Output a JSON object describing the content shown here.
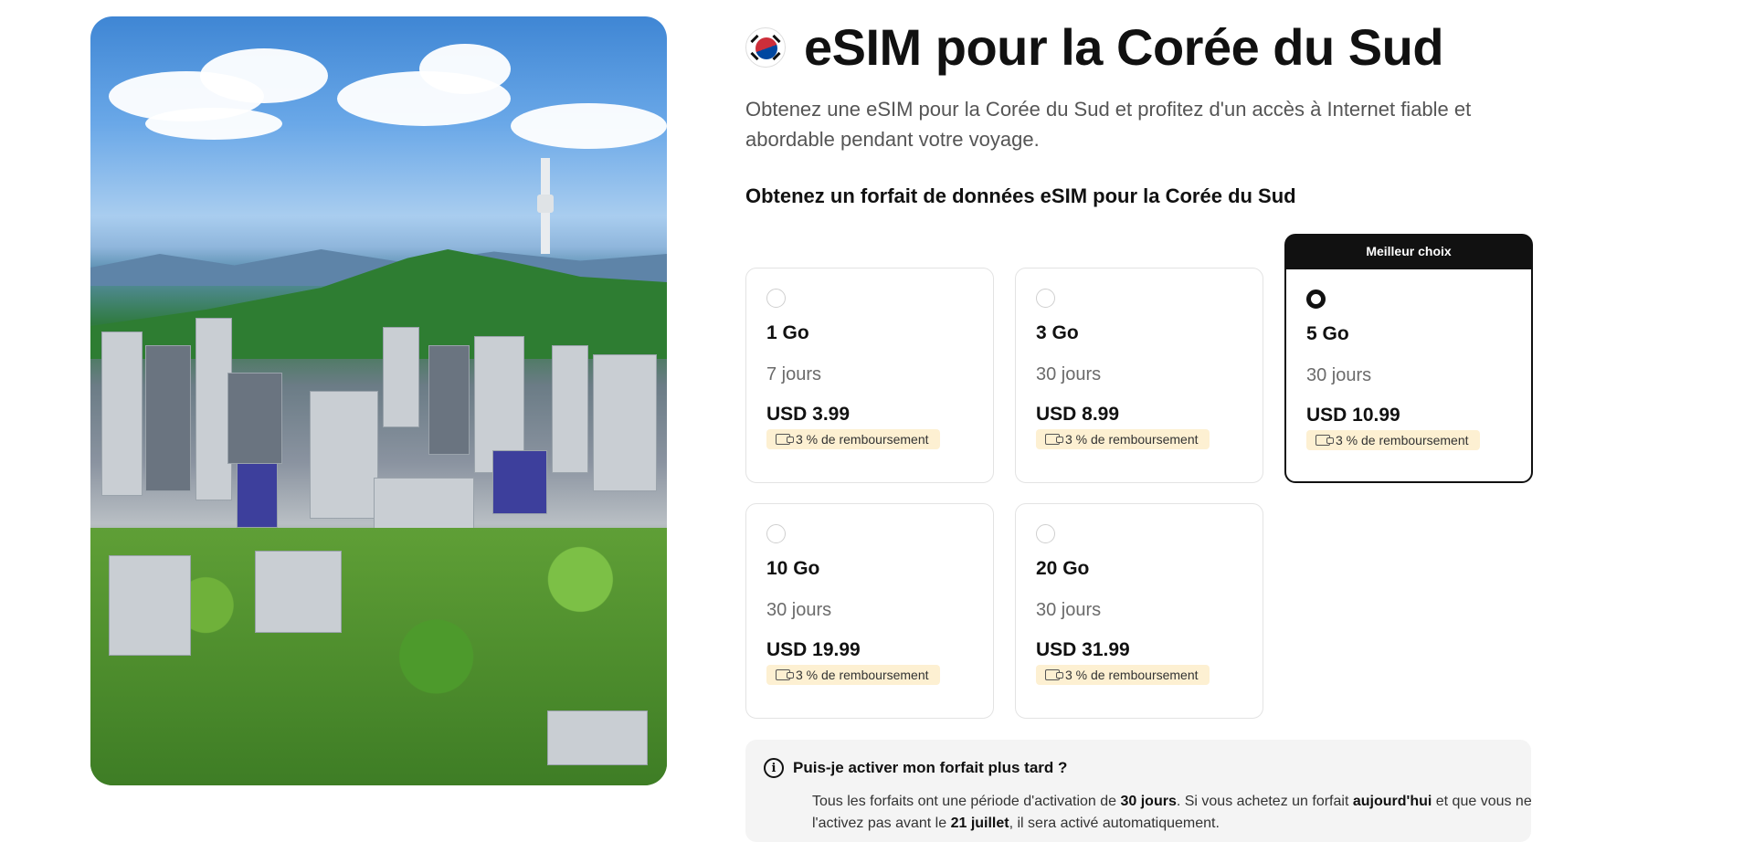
{
  "page": {
    "title": "eSIM pour la Corée du Sud",
    "subtitle": "Obtenez une eSIM pour la Corée du Sud et profitez d'un accès à Internet fiable et abordable pendant votre voyage.",
    "section_title": "Obtenez un forfait de données eSIM pour la Corée du Sud"
  },
  "hero_image": {
    "description_icon": "seoul-skyline-image"
  },
  "flag_icon": "south-korea-flag-icon",
  "plans": [
    {
      "data": "1 Go",
      "validity": "7 jours",
      "price": "USD 3.99",
      "cashback": "3 % de remboursement",
      "selected": false
    },
    {
      "data": "3 Go",
      "validity": "30 jours",
      "price": "USD 8.99",
      "cashback": "3 % de remboursement",
      "selected": false
    },
    {
      "data": "5 Go",
      "validity": "30 jours",
      "price": "USD 10.99",
      "cashback": "3 % de remboursement",
      "selected": true,
      "badge": "Meilleur choix"
    },
    {
      "data": "10 Go",
      "validity": "30 jours",
      "price": "USD 19.99",
      "cashback": "3 % de remboursement",
      "selected": false
    },
    {
      "data": "20 Go",
      "validity": "30 jours",
      "price": "USD 31.99",
      "cashback": "3 % de remboursement",
      "selected": false
    }
  ],
  "faq": {
    "question": "Puis-je activer mon forfait plus tard ?",
    "answer_parts": {
      "p1": "Tous les forfaits ont une période d'activation de ",
      "b1": "30 jours",
      "p2": ". Si vous achetez un forfait ",
      "b2": "aujourd'hui",
      "p3": " et que vous ne l'activez pas avant le ",
      "b3": "21 juillet",
      "p4": ", il sera activé automatiquement."
    }
  },
  "colors": {
    "text": "#111111",
    "muted": "#6b6b6b",
    "badge_bg": "#111111",
    "cashback_bg": "#fdf0d2",
    "faq_bg": "#f4f4f4"
  }
}
